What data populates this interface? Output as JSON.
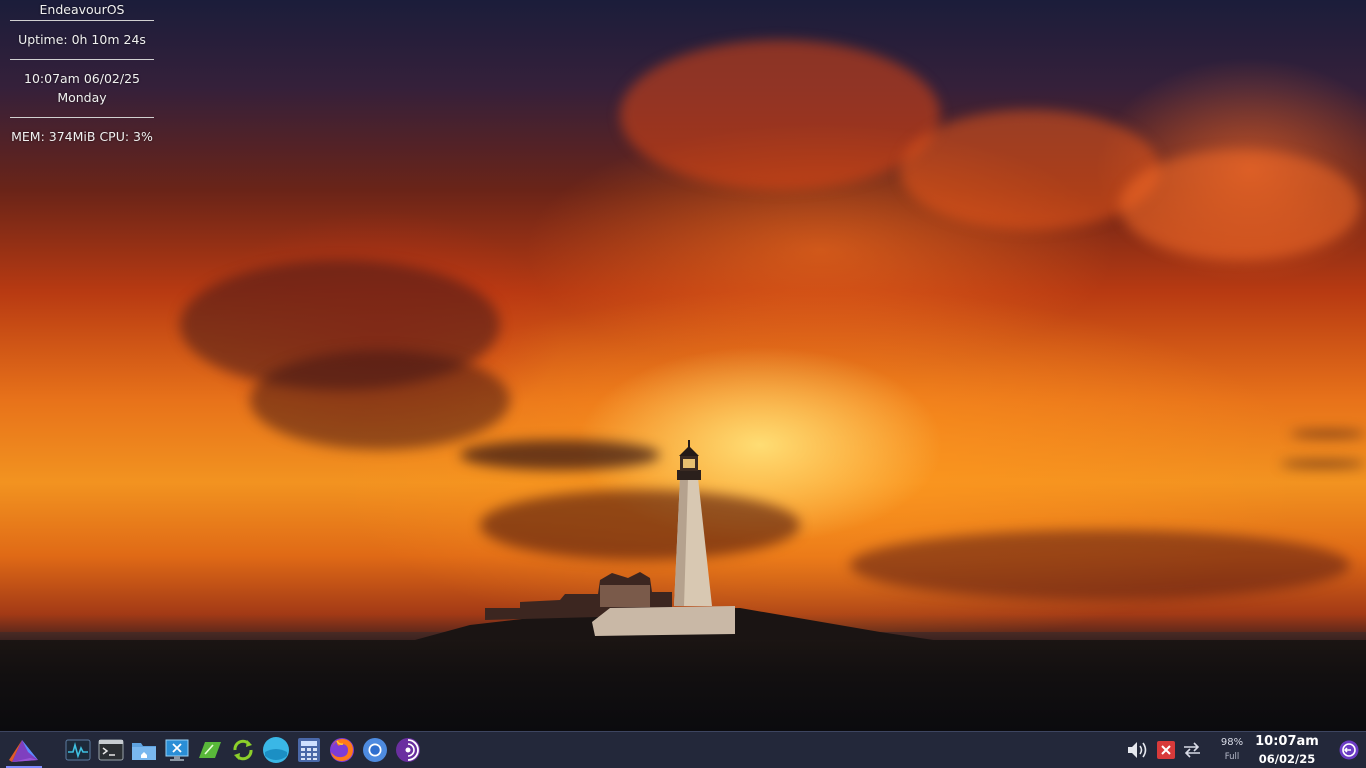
{
  "conky": {
    "hostname": "EndeavourOS",
    "uptime": "Uptime: 0h 10m 24s",
    "datetime": "10:07am  06/02/25",
    "weekday": "Monday",
    "stats": "MEM: 374MiB  CPU: 3%"
  },
  "taskbar": {
    "launcher_icon": "endeavouros-logo-icon",
    "pinned": [
      {
        "name": "system-monitor-icon"
      },
      {
        "name": "terminal-icon"
      },
      {
        "name": "file-manager-icon"
      },
      {
        "name": "remote-desktop-icon"
      },
      {
        "name": "text-editor-icon"
      },
      {
        "name": "update-manager-icon"
      },
      {
        "name": "app-store-icon"
      },
      {
        "name": "calculator-icon"
      },
      {
        "name": "firefox-icon"
      },
      {
        "name": "chromium-icon"
      },
      {
        "name": "tor-browser-icon"
      }
    ],
    "tray": {
      "volume_icon": "volume-icon",
      "bluetooth_disabled_icon": "error-icon",
      "network_icon": "network-transfer-icon",
      "battery_percent": "98%",
      "battery_state": "Full",
      "time": "10:07am",
      "date": "06/02/25",
      "logout_icon": "logout-icon"
    }
  },
  "colors": {
    "taskbar_bg": "#23283a",
    "accent": "#7f8cff",
    "text": "#ffffff"
  }
}
